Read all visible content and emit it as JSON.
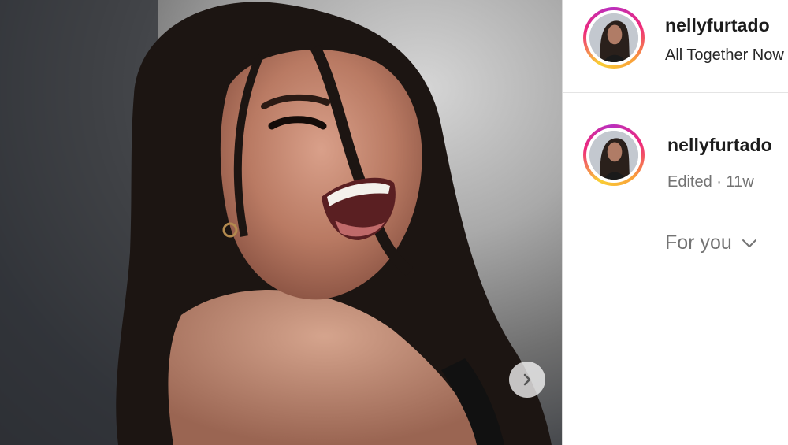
{
  "post": {
    "next_button_icon": "chevron-right-icon"
  },
  "header": {
    "username": "nellyfurtado",
    "subtitle": "All Together Now"
  },
  "caption": {
    "username": "nellyfurtado",
    "edited_label": "Edited",
    "separator": "·",
    "age": "11w"
  },
  "comments": {
    "sort_label": "For you",
    "sort_icon": "chevron-down-icon"
  },
  "colors": {
    "ring_yellow": "#f9ce34",
    "ring_pink": "#ee2a7b",
    "ring_purple": "#b92fbf",
    "text_primary": "#1c1c1c",
    "text_secondary": "#737373"
  }
}
